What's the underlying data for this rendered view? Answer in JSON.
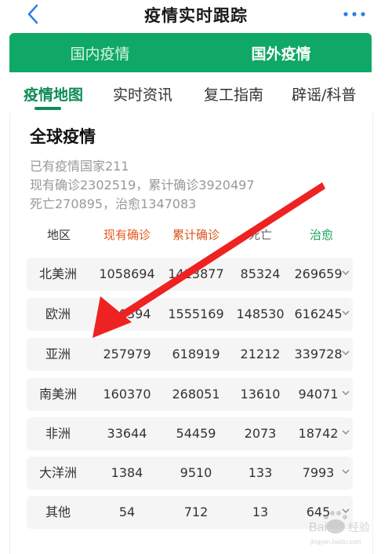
{
  "nav": {
    "title": "疫情实时跟踪",
    "back_icon": "chevron-left-icon",
    "more_icon": "more-dots-icon"
  },
  "segments": {
    "left": "国内疫情",
    "right": "国外疫情",
    "accent": "#0fa866"
  },
  "tabs": [
    {
      "label": "疫情地图",
      "active": true
    },
    {
      "label": "实时资讯",
      "active": false
    },
    {
      "label": "复工指南",
      "active": false
    },
    {
      "label": "辟谣/科普",
      "active": false
    }
  ],
  "section": {
    "title": "全球疫情",
    "line1": "已有疫情国家211",
    "line2": "现有确诊2302519，累计确诊3920497",
    "line3": "死亡270895，治愈1347083"
  },
  "table": {
    "headers": {
      "region": "地区",
      "current": "现有确诊",
      "total": "累计确诊",
      "deaths": "死亡",
      "cured": "治愈"
    },
    "rows": [
      {
        "region": "北美洲",
        "current": "1058694",
        "total": "1413877",
        "deaths": "85324",
        "cured": "269659"
      },
      {
        "region": "欧洲",
        "current": "790394",
        "total": "1555169",
        "deaths": "148530",
        "cured": "616245"
      },
      {
        "region": "亚洲",
        "current": "257979",
        "total": "618919",
        "deaths": "21212",
        "cured": "339728"
      },
      {
        "region": "南美洲",
        "current": "160370",
        "total": "268051",
        "deaths": "13610",
        "cured": "94071"
      },
      {
        "region": "非洲",
        "current": "33644",
        "total": "54459",
        "deaths": "2073",
        "cured": "18742"
      },
      {
        "region": "大洋洲",
        "current": "1384",
        "total": "9510",
        "deaths": "133",
        "cured": "7993"
      },
      {
        "region": "其他",
        "current": "54",
        "total": "712",
        "deaths": "13",
        "cured": "645"
      }
    ]
  },
  "annotation": {
    "arrow_color": "#ee2222"
  },
  "watermark": {
    "text": "Bai 经验",
    "sub": "jingyan.baidu.com"
  }
}
